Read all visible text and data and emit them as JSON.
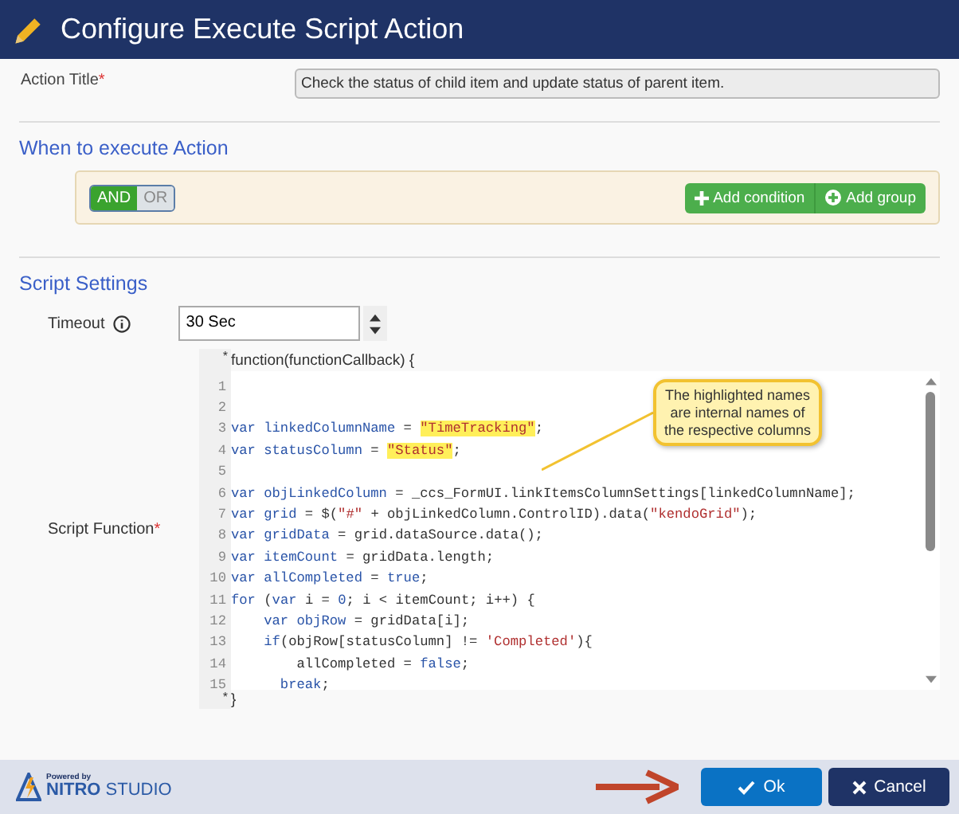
{
  "window": {
    "title": "Configure Execute Script Action"
  },
  "action_title": {
    "label": "Action Title",
    "required_mark": "*",
    "value": "Check the status of child item and update status of parent item."
  },
  "when_section": {
    "heading": "When to execute Action",
    "logic_toggle": [
      {
        "label": "AND",
        "selected": true
      },
      {
        "label": "OR",
        "selected": false
      }
    ],
    "buttons": [
      {
        "label": "Add condition",
        "kind": "plus"
      },
      {
        "label": "Add group",
        "kind": "circle-plus"
      }
    ]
  },
  "script_section": {
    "heading": "Script Settings",
    "timeout": {
      "label": "Timeout",
      "value": "30 Sec"
    },
    "script_function": {
      "label": "Script Function",
      "required_mark": "*",
      "header": "function(functionCallback) {",
      "header_mark": "*",
      "footer": "}",
      "footer_mark": "*",
      "lines": [
        {
          "number": "1"
        },
        {
          "number": "2"
        },
        {
          "number": "3",
          "tokens": [
            {
              "kind": "code",
              "text": "var linkedColumnName"
            },
            {
              "kind": "punct",
              "text": " = "
            },
            {
              "kind": "hl",
              "text": "\"TimeTracking\""
            },
            {
              "kind": "punct",
              "text": ";"
            }
          ]
        },
        {
          "number": "4",
          "tokens": [
            {
              "kind": "code",
              "text": "var statusColumn"
            },
            {
              "kind": "punct",
              "text": " = "
            },
            {
              "kind": "hl",
              "text": "\"Status\""
            },
            {
              "kind": "punct",
              "text": ";"
            }
          ]
        },
        {
          "number": "5"
        },
        {
          "number": "6",
          "tokens": [
            {
              "kind": "code",
              "text": "var objLinkedColumn"
            },
            {
              "kind": "punct",
              "text": " = _ccs_FormUI.linkItemsColumnSettings[linkedColumnName];"
            }
          ]
        },
        {
          "number": "7",
          "tokens": [
            {
              "kind": "code",
              "text": "var grid"
            },
            {
              "kind": "punct",
              "text": " = $("
            },
            {
              "kind": "str",
              "text": "\"#\""
            },
            {
              "kind": "punct",
              "text": " + objLinkedColumn.ControlID).data("
            },
            {
              "kind": "str",
              "text": "\"kendoGrid\""
            },
            {
              "kind": "punct",
              "text": ");"
            }
          ]
        },
        {
          "number": "8",
          "tokens": [
            {
              "kind": "code",
              "text": "var gridData"
            },
            {
              "kind": "punct",
              "text": " = grid.dataSource.data();"
            }
          ]
        },
        {
          "number": "9",
          "tokens": [
            {
              "kind": "code",
              "text": "var itemCount"
            },
            {
              "kind": "punct",
              "text": " = gridData.length;"
            }
          ]
        },
        {
          "number": "10",
          "tokens": [
            {
              "kind": "code",
              "text": "var allCompleted"
            },
            {
              "kind": "punct",
              "text": " = "
            },
            {
              "kind": "code",
              "text": "true"
            },
            {
              "kind": "punct",
              "text": ";"
            }
          ]
        },
        {
          "number": "11",
          "tokens": [
            {
              "kind": "code",
              "text": "for"
            },
            {
              "kind": "punct",
              "text": " ("
            },
            {
              "kind": "code",
              "text": "var"
            },
            {
              "kind": "punct",
              "text": " i = "
            },
            {
              "kind": "code",
              "text": "0"
            },
            {
              "kind": "punct",
              "text": "; i < itemCount; i++) {"
            }
          ]
        },
        {
          "number": "12",
          "tokens": [
            {
              "kind": "code",
              "text": "    var objRow"
            },
            {
              "kind": "punct",
              "text": " = gridData[i];"
            }
          ]
        },
        {
          "number": "13",
          "tokens": [
            {
              "kind": "code",
              "text": "    if"
            },
            {
              "kind": "punct",
              "text": "(objRow[statusColumn] != "
            },
            {
              "kind": "str",
              "text": "'Completed'"
            },
            {
              "kind": "punct",
              "text": "){"
            }
          ]
        },
        {
          "number": "14",
          "tokens": [
            {
              "kind": "punct",
              "text": "        allCompleted = "
            },
            {
              "kind": "code",
              "text": "false"
            },
            {
              "kind": "punct",
              "text": ";"
            }
          ]
        },
        {
          "number": "15",
          "tokens": [
            {
              "kind": "code",
              "text": "      break"
            },
            {
              "kind": "punct",
              "text": ";"
            }
          ]
        }
      ]
    },
    "callout": "The highlighted names are internal names of the respective columns"
  },
  "footer": {
    "brand_small": "Powered by",
    "brand_bold": "NITRO",
    "brand_light": "STUDIO",
    "buttons": [
      {
        "label": "Ok",
        "kind": "ok"
      },
      {
        "label": "Cancel",
        "kind": "cancel"
      }
    ]
  }
}
